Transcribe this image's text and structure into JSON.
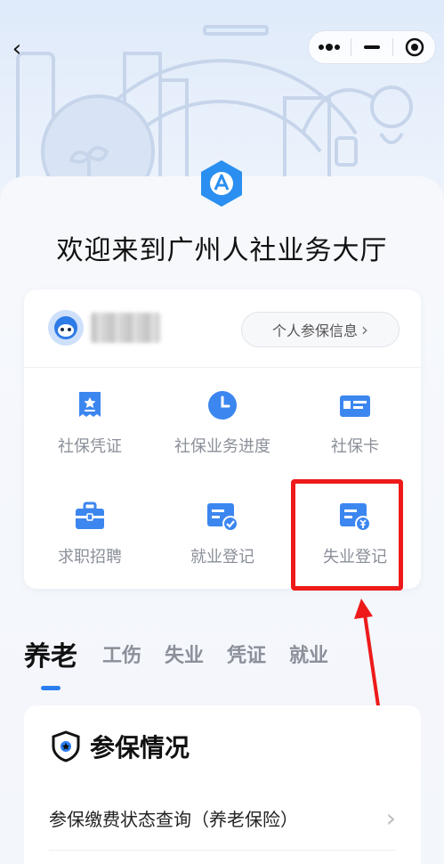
{
  "nav": {
    "back": "‹"
  },
  "capsule": {
    "more": "•••",
    "minimize": "—"
  },
  "page": {
    "title": "欢迎来到广州人社业务大厅"
  },
  "user": {
    "info_button": "个人参保信息",
    "info_chevron": "›"
  },
  "services": [
    {
      "label": "社保凭证",
      "icon": "voucher-icon"
    },
    {
      "label": "社保业务进度",
      "icon": "clock-icon"
    },
    {
      "label": "社保卡",
      "icon": "card-icon"
    },
    {
      "label": "求职招聘",
      "icon": "briefcase-icon"
    },
    {
      "label": "就业登记",
      "icon": "employment-register-icon"
    },
    {
      "label": "失业登记",
      "icon": "unemployment-register-icon"
    }
  ],
  "tabs": [
    "养老",
    "工伤",
    "失业",
    "凭证",
    "就业"
  ],
  "section": {
    "title": "参保情况",
    "rows": [
      {
        "label": "参保缴费状态查询（养老保险）",
        "chevron": "›"
      }
    ]
  },
  "colors": {
    "accent": "#2a7ef0",
    "highlight": "#ee1a1a",
    "icon_blue": "#3c86ef"
  }
}
